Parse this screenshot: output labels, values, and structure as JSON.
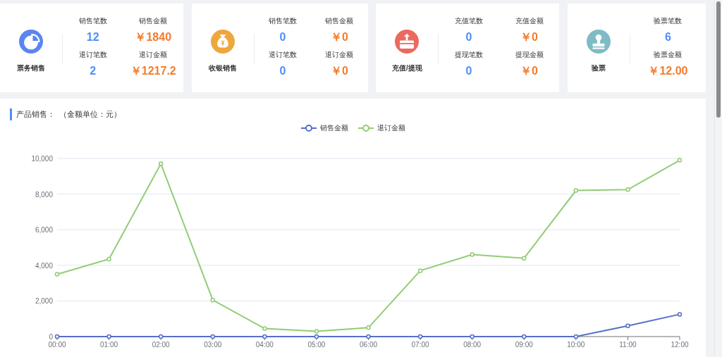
{
  "summary_cards": [
    {
      "title": "票务销售",
      "kind": "pie",
      "metrics": [
        {
          "label": "销售笔数",
          "value": "12",
          "kind": "count"
        },
        {
          "label": "销售金额",
          "value": "￥1840",
          "kind": "amount"
        },
        {
          "label": "退订笔数",
          "value": "2",
          "kind": "count"
        },
        {
          "label": "退订金额",
          "value": "￥1217.2",
          "kind": "amount"
        }
      ]
    },
    {
      "title": "收银销售",
      "kind": "bag",
      "metrics": [
        {
          "label": "销售笔数",
          "value": "0",
          "kind": "count"
        },
        {
          "label": "销售金额",
          "value": "￥0",
          "kind": "amount"
        },
        {
          "label": "退订笔数",
          "value": "0",
          "kind": "count"
        },
        {
          "label": "退订金额",
          "value": "￥0",
          "kind": "amount"
        }
      ]
    },
    {
      "title": "充值/提现",
      "kind": "box",
      "metrics": [
        {
          "label": "充值笔数",
          "value": "0",
          "kind": "count"
        },
        {
          "label": "充值金额",
          "value": "￥0",
          "kind": "amount"
        },
        {
          "label": "提现笔数",
          "value": "0",
          "kind": "count"
        },
        {
          "label": "提现金额",
          "value": "￥0",
          "kind": "amount"
        }
      ]
    },
    {
      "title": "验票",
      "kind": "stamp",
      "metrics": [
        {
          "label": "验票笔数",
          "value": "6",
          "kind": "count"
        },
        {
          "label": "验票金额",
          "value": "￥12.00",
          "kind": "amount"
        }
      ]
    }
  ],
  "sales_panel": {
    "title": "产品销售：",
    "unit_note": "（金额单位：元）",
    "chart_data": {
      "type": "line",
      "grid": true,
      "categories": [
        "00:00",
        "01:00",
        "02:00",
        "03:00",
        "04:00",
        "05:00",
        "06:00",
        "07:00",
        "08:00",
        "09:00",
        "10:00",
        "11:00",
        "12:00"
      ],
      "ylim": [
        0,
        10000
      ],
      "yticks": [
        {
          "value": 0,
          "label": "0"
        },
        {
          "value": 2000,
          "label": "2,000"
        },
        {
          "value": 4000,
          "label": "4,000"
        },
        {
          "value": 6000,
          "label": "6,000"
        },
        {
          "value": 8000,
          "label": "8,000"
        },
        {
          "value": 10000,
          "label": "10,000"
        }
      ],
      "series": [
        {
          "name": "销售金额",
          "color": "#5470c6",
          "marker": "circle",
          "values": [
            0,
            0,
            0,
            0,
            0,
            0,
            0,
            0,
            0,
            0,
            0,
            600,
            1250
          ]
        },
        {
          "name": "退订金额",
          "color": "#91cc75",
          "marker": "circle",
          "values": [
            3500,
            4350,
            9700,
            2050,
            450,
            300,
            500,
            3700,
            4600,
            4400,
            8200,
            8250,
            9900
          ]
        }
      ]
    }
  }
}
